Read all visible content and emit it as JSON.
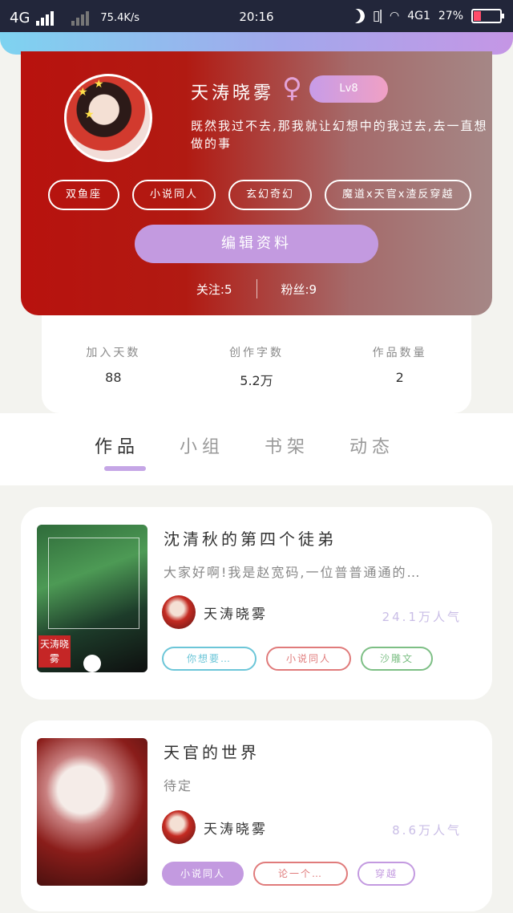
{
  "status_bar": {
    "network": "4G",
    "speed": "75.4K/s",
    "time": "20:16",
    "network2": "4G1",
    "battery": "27%"
  },
  "profile": {
    "username": "天涛晓雾",
    "gender_symbol": "♀",
    "level": "Lv8",
    "bio": "既然我过不去,那我就让幻想中的我过去,去一直想做的事",
    "tags": [
      "双鱼座",
      "小说同人",
      "玄幻奇幻",
      "魔道x天官x渣反穿越"
    ],
    "edit_label": "编辑资料",
    "following": "关注:5",
    "followers": "粉丝:9"
  },
  "stats": [
    {
      "label": "加入天数",
      "value": "88"
    },
    {
      "label": "创作字数",
      "value": "5.2万"
    },
    {
      "label": "作品数量",
      "value": "2"
    }
  ],
  "tabs": [
    "作品",
    "小组",
    "书架",
    "动态"
  ],
  "works": [
    {
      "title": "沈清秋的第四个徒弟",
      "desc": "大家好啊!我是赵宽码,一位普普通通的…",
      "author": "天涛晓雾",
      "popularity": "24.1万人气",
      "cover_stamp": "天涛晓雾",
      "tags": [
        {
          "label": "你想要…",
          "color": "#6cc6d8"
        },
        {
          "label": "小说同人",
          "color": "#e07b7b"
        },
        {
          "label": "沙雕文",
          "color": "#7dbf85"
        }
      ]
    },
    {
      "title": "天官的世界",
      "desc": "待定",
      "author": "天涛晓雾",
      "popularity": "8.6万人气",
      "tags": [
        {
          "label": "小说同人",
          "color": "#c39ae0",
          "filled": true
        },
        {
          "label": "论一个…",
          "color": "#e07b7b"
        },
        {
          "label": "穿越",
          "color": "#c39ae0"
        }
      ]
    }
  ],
  "colors": {
    "accent": "#c39ae0",
    "profile_bg_start": "#b8120e",
    "profile_bg_end": "#a58786"
  }
}
